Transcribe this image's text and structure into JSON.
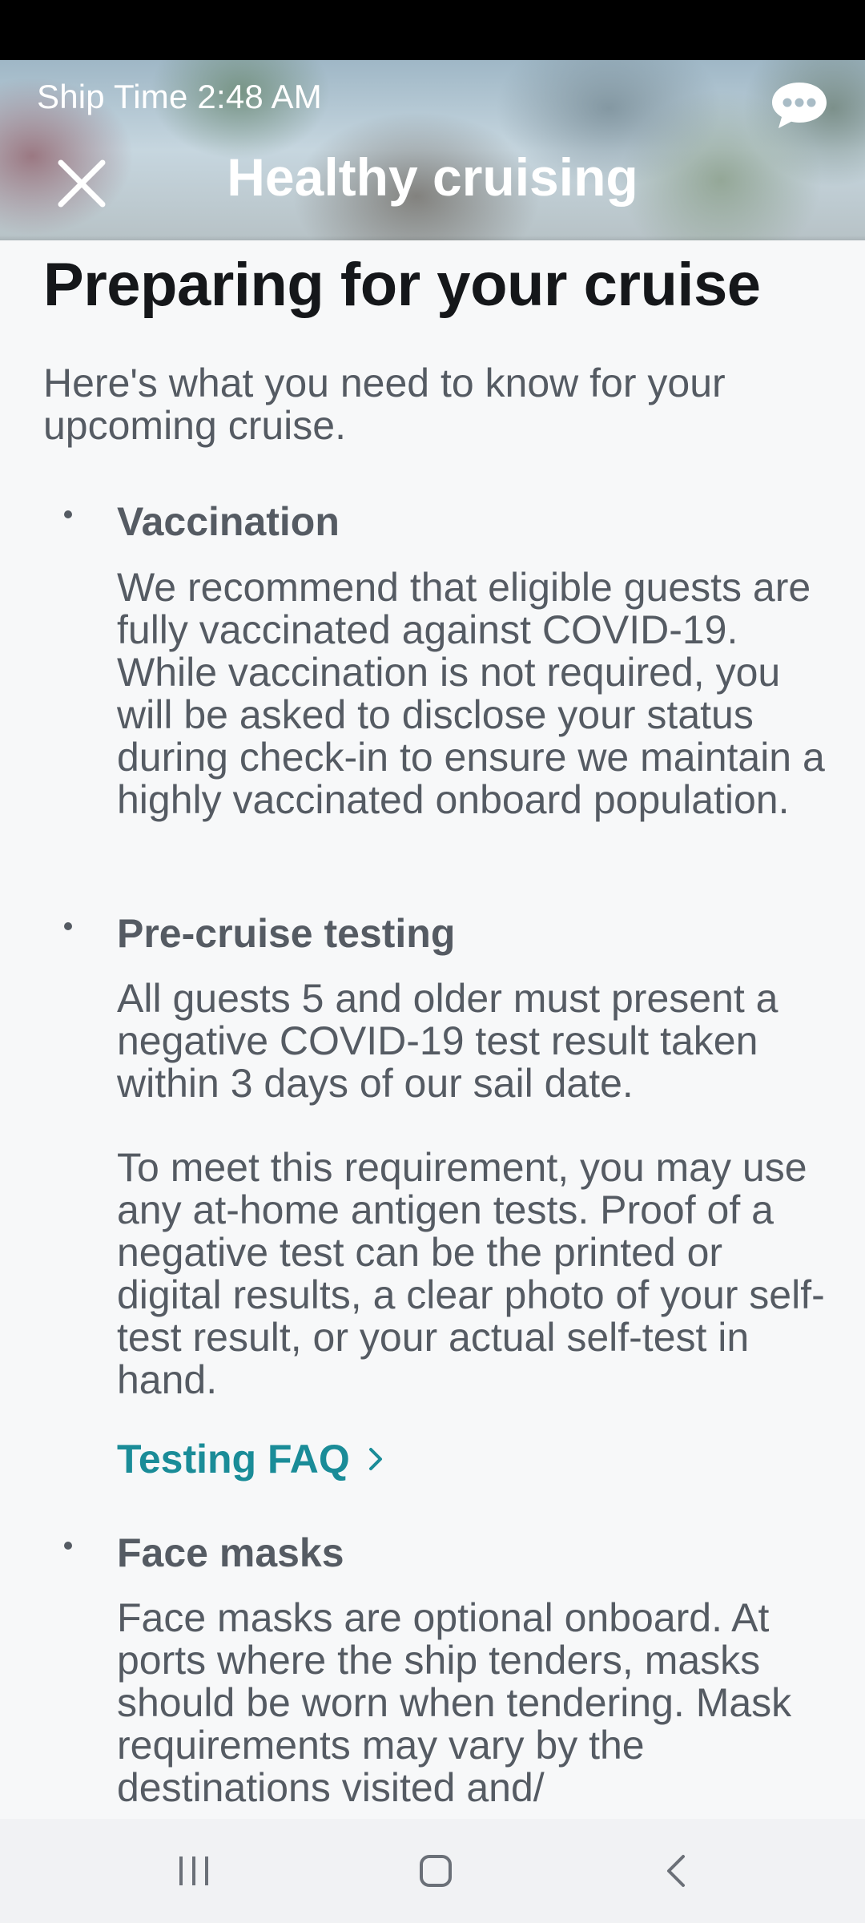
{
  "status_bar": {},
  "header": {
    "ship_time": "Ship Time 2:48 AM",
    "title": "Healthy cruising",
    "icons": {
      "close": "close-icon",
      "chat": "chat-bubble-icon"
    }
  },
  "main": {
    "title": "Preparing for your cruise",
    "intro": "Here's what you need to know for your upcoming cruise.",
    "sections": [
      {
        "heading": "Vaccination",
        "body": "We recommend that eligible guests are fully vaccinated against COVID-19. While vaccination is not required, you will be asked to disclose your status during check-in to ensure we maintain a highly vaccinated onboard population."
      },
      {
        "heading": "Pre-cruise testing",
        "body": "All guests 5 and older must present a negative COVID-19 test result taken within 3 days of our sail date.",
        "body2": "To meet this requirement, you may use any at-home antigen tests. Proof of a negative test can be the printed or digital results, a clear photo of your self-test result, or your actual self-test in hand.",
        "link_label": "Testing FAQ"
      },
      {
        "heading": "Face masks",
        "body": "Face masks are optional onboard. At ports where the ship tenders, masks should be worn when tendering. Mask requirements may vary by the destinations visited and/"
      }
    ]
  },
  "nav_bar": {
    "icons": [
      "recent-apps-icon",
      "home-icon",
      "back-icon"
    ]
  },
  "colors": {
    "link": "#1a8c98",
    "title": "#15171a",
    "body_text": "#555b63",
    "background": "#f7f8f9"
  }
}
